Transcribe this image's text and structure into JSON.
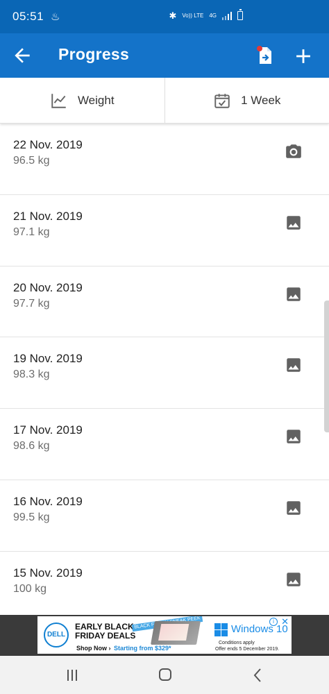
{
  "status_bar": {
    "time": "05:51",
    "left_icon": "notification-icon",
    "volte_label": "Vo)) LTE",
    "network_label": "4G",
    "colors": {
      "background": "#0a66b5"
    }
  },
  "app_bar": {
    "back_icon": "arrow-back-icon",
    "title": "Progress",
    "export_icon": "export-document-icon",
    "add_icon": "plus-icon",
    "colors": {
      "background": "#1473c9",
      "badge": "#e53935"
    }
  },
  "toggles": {
    "metric": {
      "icon": "line-chart-icon",
      "label": "Weight"
    },
    "period": {
      "icon": "calendar-check-icon",
      "label": "1 Week"
    }
  },
  "entries": [
    {
      "date": "22 Nov. 2019",
      "weight": "96.5 kg",
      "icon": "camera-icon"
    },
    {
      "date": "21 Nov. 2019",
      "weight": "97.1 kg",
      "icon": "image-icon"
    },
    {
      "date": "20 Nov. 2019",
      "weight": "97.7 kg",
      "icon": "image-icon"
    },
    {
      "date": "19 Nov. 2019",
      "weight": "98.3 kg",
      "icon": "image-icon"
    },
    {
      "date": "17 Nov. 2019",
      "weight": "98.6 kg",
      "icon": "image-icon"
    },
    {
      "date": "16 Nov. 2019",
      "weight": "99.5 kg",
      "icon": "image-icon"
    },
    {
      "date": "15 Nov. 2019",
      "weight": "100 kg",
      "icon": "image-icon"
    }
  ],
  "ad": {
    "brand": "DELL",
    "headline": "EARLY BLACK FRIDAY DEALS",
    "sticker": "BLACK FRIDAY SNEAK PEEK",
    "shop_now": "Shop Now ›",
    "starting_from": "Starting from $329*",
    "windows_label": "Windows 10",
    "conditions": "Conditions apply",
    "offer_ends": "Offer ends 5 December 2019."
  },
  "nav_bar": {
    "recents_icon": "recents-icon",
    "home_icon": "home-icon",
    "back_icon": "system-back-icon"
  }
}
